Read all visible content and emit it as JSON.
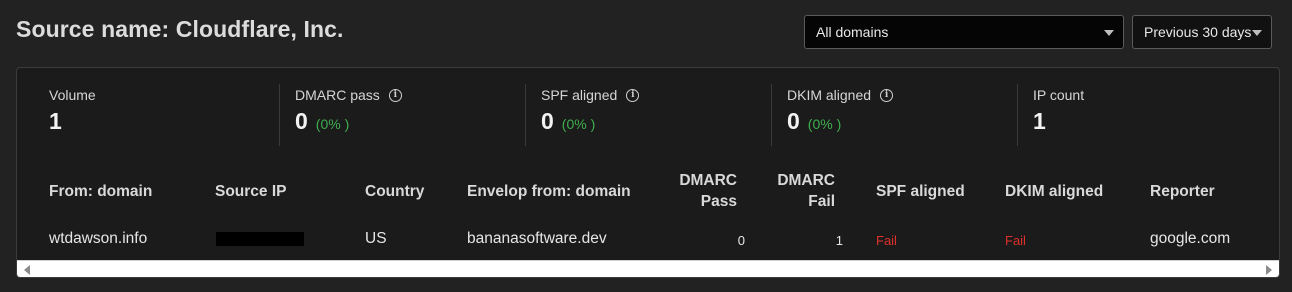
{
  "header": {
    "title": "Source name: Cloudflare, Inc."
  },
  "filters": {
    "domain_select": "All domains",
    "period_select": "Previous 30 days"
  },
  "stats": [
    {
      "label": "Volume",
      "value": "1",
      "pct": ""
    },
    {
      "label": "DMARC pass",
      "value": "0",
      "pct": "(0% )"
    },
    {
      "label": "SPF aligned",
      "value": "0",
      "pct": "(0% )"
    },
    {
      "label": "DKIM aligned",
      "value": "0",
      "pct": "(0% )"
    },
    {
      "label": "IP count",
      "value": "1",
      "pct": ""
    }
  ],
  "table": {
    "headers": {
      "from_domain": "From: domain",
      "source_ip": "Source IP",
      "country": "Country",
      "envelop_from": "Envelop from: domain",
      "dmarc_pass_1": "DMARC",
      "dmarc_pass_2": "Pass",
      "dmarc_fail_1": "DMARC",
      "dmarc_fail_2": "Fail",
      "spf_aligned": "SPF aligned",
      "dkim_aligned": "DKIM aligned",
      "reporter": "Reporter"
    },
    "rows": [
      {
        "from_domain": "wtdawson.info",
        "source_ip": "",
        "country": "US",
        "envelop_from": "bananasoftware.dev",
        "dmarc_pass": "0",
        "dmarc_fail": "1",
        "spf_aligned": "Fail",
        "dkim_aligned": "Fail",
        "reporter": "google.com"
      }
    ]
  },
  "colors": {
    "background": "#222222",
    "panel": "#1b1b1b",
    "pass_green": "#3fae4f",
    "fail_red": "#e0302a"
  }
}
